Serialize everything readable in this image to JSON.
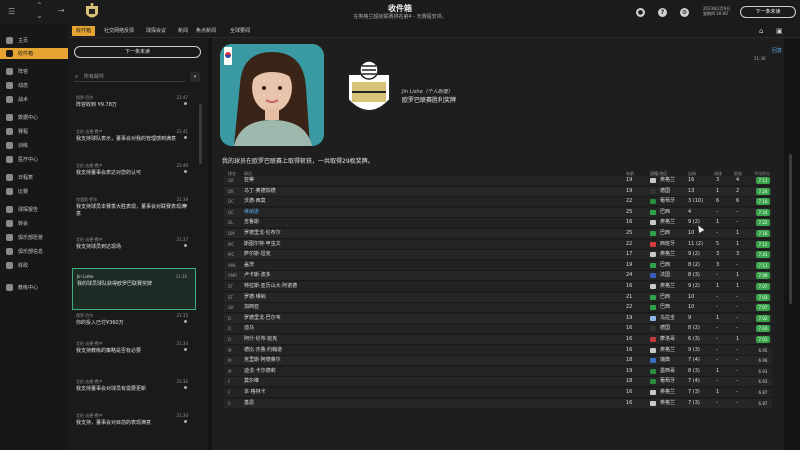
{
  "header": {
    "title": "收件箱",
    "subtitle": "在英格兰超级联赛排名第4 - 无赛程安排。",
    "date_line1": "2023年2月9日",
    "date_line2": "星期四 20:00",
    "continue_label": "下一条未读"
  },
  "sidebar": {
    "items": [
      {
        "label": "主页"
      },
      {
        "label": "收件箱"
      },
      {
        "label": "阵容"
      },
      {
        "label": "动态"
      },
      {
        "label": "战术"
      },
      {
        "label": "数据中心"
      },
      {
        "label": "赛程"
      },
      {
        "label": "训练"
      },
      {
        "label": "医疗中心"
      },
      {
        "label": "日程表"
      },
      {
        "label": "比赛"
      },
      {
        "label": "球探报告"
      },
      {
        "label": "转会"
      },
      {
        "label": "俱乐部愿景"
      },
      {
        "label": "俱乐部信息"
      },
      {
        "label": "财政"
      },
      {
        "label": "教练中心"
      }
    ]
  },
  "tabs": [
    "收件箱",
    "社交网络反馈",
    "球探会议",
    "新闻",
    "焦点新闻",
    "全球要闻"
  ],
  "inbox": {
    "continue_label": "下一条未读",
    "search_placeholder": "所有邮件",
    "filter_label": "▾",
    "messages": [
      {
        "from": "保罗·巴尔",
        "subject": "阵容收到 ¥9.78万",
        "time": "21:47"
      },
      {
        "from": "艾伦·达德·费卢",
        "subject": "我支持球队表示，董事会对我的管理感到满意",
        "time": "21:41"
      },
      {
        "from": "艾伦·达德·费卢",
        "subject": "我支持董事会表达对您的认可",
        "time": "21:40"
      },
      {
        "from": "克里斯·罗尔",
        "subject": "我支持球员本赛季大胜表现，董事会对联赛表现满意",
        "time": "21:39"
      },
      {
        "from": "艾伦·达德·费卢",
        "subject": "我支持球员到达现场",
        "time": "21:37"
      },
      {
        "from": "Jin Lishe",
        "subject": "我的球员球队获得欧罗巴联赛奖牌",
        "time": "21:36"
      },
      {
        "from": "保罗·巴尔",
        "subject": "你的投入已付¥360万",
        "time": "21:35"
      },
      {
        "from": "艾伦·达德·费卢",
        "subject": "我支持教练的策略是否有必要",
        "time": "21:34"
      },
      {
        "from": "艾伦·达德·费卢",
        "subject": "我支持董事会对球员有需要更新",
        "time": "21:32"
      },
      {
        "from": "艾伦·达德·费卢",
        "subject": "我支持，董事会对目前的表现满意",
        "time": "21:30"
      }
    ]
  },
  "message": {
    "sender": "Jin Lishe（个人助理）",
    "title": "欧罗巴联赛胜利奖牌",
    "time": "21:36",
    "reply": "回复",
    "body": "我的球员在欧罗巴联赛上取得斩获，一共取得29枚奖牌。"
  },
  "table": {
    "headers": [
      "排名",
      "球员",
      "年龄",
      "国籍/地区",
      "出场",
      "进球",
      "助攻",
      "平均评分"
    ],
    "rows": [
      {
        "pos": "GK",
        "name": "亚蒂",
        "age": "19",
        "nat": "英格兰",
        "apps": "16",
        "g": "3",
        "a": "4",
        "av": "7.11",
        "flag": "#c8c8c8"
      },
      {
        "pos": "DR",
        "name": "马丁·奥德加德",
        "age": "19",
        "nat": "德国",
        "apps": "13",
        "g": "1",
        "a": "2",
        "av": "7.24",
        "flag": "#333333"
      },
      {
        "pos": "DC",
        "name": "沃德·西莫",
        "age": "22",
        "nat": "葡萄牙",
        "apps": "3 (10)",
        "g": "6",
        "a": "6",
        "av": "7.10",
        "flag": "#2b8c3d"
      },
      {
        "pos": "DC",
        "name": "维纳逊",
        "age": "25",
        "nat": "巴西",
        "apps": "4",
        "g": "-",
        "a": "-",
        "av": "7.24",
        "flag": "#2ea34a",
        "link": true
      },
      {
        "pos": "DL",
        "name": "吉鲁斯",
        "age": "16",
        "nat": "英格兰",
        "apps": "9 (2)",
        "g": "1",
        "a": "-",
        "av": "7.22",
        "flag": "#c8c8c8"
      },
      {
        "pos": "DM",
        "name": "罗德里戈·伦布尔",
        "age": "25",
        "nat": "巴西",
        "apps": "10",
        "g": "-",
        "a": "1",
        "av": "7.16",
        "flag": "#2ea34a"
      },
      {
        "pos": "MC",
        "name": "斯图尔特·甲虫文",
        "age": "22",
        "nat": "西班牙",
        "apps": "11 (2)",
        "g": "5",
        "a": "1",
        "av": "7.12",
        "flag": "#d53d3d"
      },
      {
        "pos": "MC",
        "name": "萨尔斯·坦克",
        "age": "17",
        "nat": "英格兰",
        "apps": "9 (2)",
        "g": "3",
        "a": "3",
        "av": "7.41",
        "flag": "#c8c8c8"
      },
      {
        "pos": "AML",
        "name": "盖茨",
        "age": "19",
        "nat": "巴西",
        "apps": "8 (2)",
        "g": "3",
        "a": "-",
        "av": "7.11",
        "flag": "#2ea34a"
      },
      {
        "pos": "AMR",
        "name": "卢卡斯·波多",
        "age": "24",
        "nat": "法国",
        "apps": "8 (3)",
        "g": "-",
        "a": "1",
        "av": "7.09",
        "flag": "#3a5bb8"
      },
      {
        "pos": "ST",
        "name": "特拉斯·亚历山大·阿诺德",
        "age": "16",
        "nat": "英格兰",
        "apps": "9 (2)",
        "g": "1",
        "a": "1",
        "av": "7.07",
        "flag": "#c8c8c8"
      },
      {
        "pos": "ST",
        "name": "罗德·维纳",
        "age": "21",
        "nat": "巴西",
        "apps": "10",
        "g": "-",
        "a": "-",
        "av": "7.03",
        "flag": "#2ea34a"
      },
      {
        "pos": "GK",
        "name": "加西亚",
        "age": "22",
        "nat": "巴西",
        "apps": "10",
        "g": "-",
        "a": "-",
        "av": "7.07",
        "flag": "#2ea34a"
      },
      {
        "pos": "D",
        "name": "罗德里戈·巴尔韦",
        "age": "19",
        "nat": "乌拉圭",
        "apps": "9",
        "g": "1",
        "a": "-",
        "av": "7.02",
        "flag": "#8fb6e8"
      },
      {
        "pos": "D",
        "name": "迪马",
        "age": "16",
        "nat": "德国",
        "apps": "8 (2)",
        "g": "-",
        "a": "-",
        "av": "7.03",
        "flag": "#333333"
      },
      {
        "pos": "D",
        "name": "阿什·伦布·班克",
        "age": "16",
        "nat": "摩洛哥",
        "apps": "6 (3)",
        "g": "-",
        "a": "1",
        "av": "7.01",
        "flag": "#c23b3b"
      },
      {
        "pos": "M",
        "name": "德比·杰鲁·约翰逊",
        "age": "16",
        "nat": "英格兰",
        "apps": "9 (3)",
        "g": "-",
        "a": "-",
        "av": "6.95",
        "flag": "#c8c8c8"
      },
      {
        "pos": "M",
        "name": "克里斯·阿德莱尔",
        "age": "18",
        "nat": "瑞典",
        "apps": "7 (4)",
        "g": "-",
        "a": "-",
        "av": "6.96",
        "flag": "#3a6fc0"
      },
      {
        "pos": "M",
        "name": "迪戈·卡尔德莉",
        "age": "19",
        "nat": "墨西哥",
        "apps": "8 (3)",
        "g": "1",
        "a": "-",
        "av": "6.93",
        "flag": "#2b8c3d"
      },
      {
        "pos": "F",
        "name": "莫尔维",
        "age": "18",
        "nat": "葡萄牙",
        "apps": "7 (4)",
        "g": "-",
        "a": "-",
        "av": "6.93",
        "flag": "#2b8c3d"
      },
      {
        "pos": "F",
        "name": "本·格林卡",
        "age": "16",
        "nat": "英格兰",
        "apps": "7 (3)",
        "g": "1",
        "a": "-",
        "av": "6.87",
        "flag": "#c8c8c8"
      },
      {
        "pos": "S",
        "name": "基恩",
        "age": "16",
        "nat": "英格兰",
        "apps": "7 (3)",
        "g": "-",
        "a": "-",
        "av": "6.87",
        "flag": "#c8c8c8"
      }
    ]
  },
  "colors": {
    "accent": "#e6a532",
    "rating_green": "#3aa34b",
    "link_blue": "#5aa7e8",
    "selected_border": "#3fb07e"
  }
}
